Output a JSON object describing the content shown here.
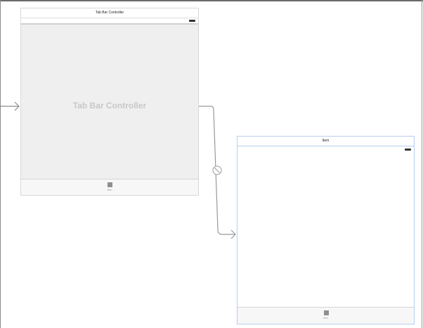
{
  "tab_bar_controller_scene": {
    "title": "Tab Bar Controller",
    "content_label": "Tab Bar Controller",
    "tab_item_label": "Item"
  },
  "item_scene": {
    "title": "Item",
    "tab_item_label": "Item"
  }
}
